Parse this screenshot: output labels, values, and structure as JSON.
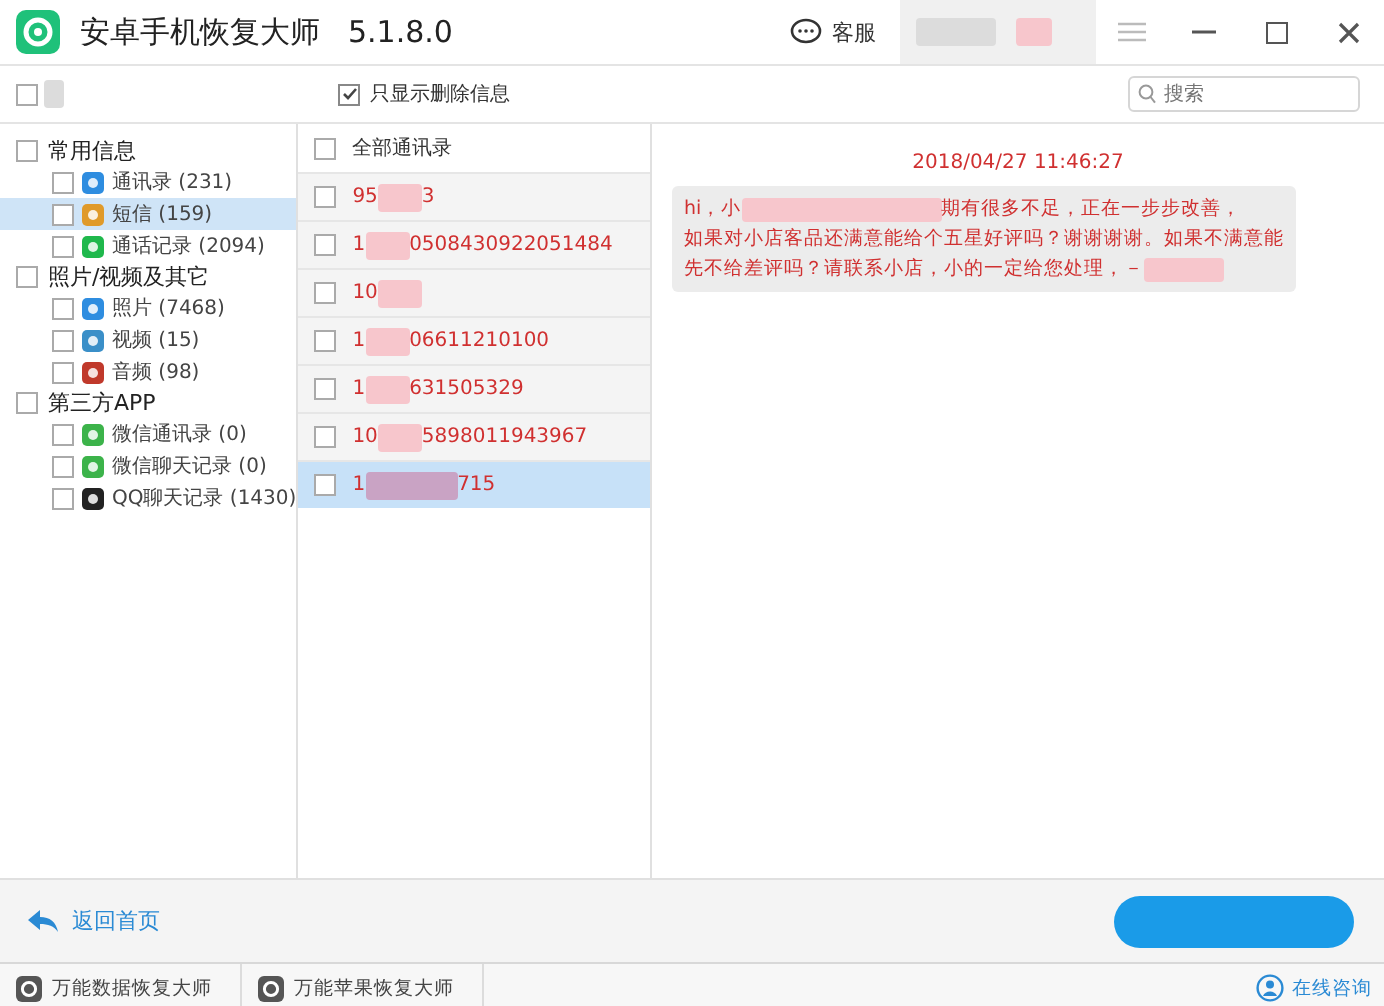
{
  "window": {
    "title": "安卓手机恢复大师",
    "version": "5.1.8.0",
    "support": "客服"
  },
  "toolbar": {
    "select_all_checked": false,
    "deleted_only": {
      "label": "只显示删除信息",
      "checked": true
    },
    "search": {
      "placeholder": "搜索"
    }
  },
  "sidebar": {
    "groups": [
      {
        "label": "常用信息",
        "checked": false,
        "children": [
          {
            "label": "通讯录 (231)",
            "kind": "contacts",
            "checked": false,
            "selected": false
          },
          {
            "label": "短信 (159)",
            "kind": "sms",
            "checked": false,
            "selected": true
          },
          {
            "label": "通话记录 (2094)",
            "kind": "phone",
            "checked": false,
            "selected": false
          }
        ]
      },
      {
        "label": "照片/视频及其它",
        "checked": false,
        "children": [
          {
            "label": "照片 (7468)",
            "kind": "photo",
            "checked": false,
            "selected": false
          },
          {
            "label": "视频 (15)",
            "kind": "video",
            "checked": false,
            "selected": false
          },
          {
            "label": "音频 (98)",
            "kind": "audio",
            "checked": false,
            "selected": false
          }
        ]
      },
      {
        "label": "第三方APP",
        "checked": false,
        "children": [
          {
            "label": "微信通讯录 (0)",
            "kind": "wechat",
            "checked": false,
            "selected": false
          },
          {
            "label": "微信聊天记录 (0)",
            "kind": "wechat",
            "checked": false,
            "selected": false
          },
          {
            "label": "QQ聊天记录 (1430)",
            "kind": "qq",
            "checked": false,
            "selected": false
          }
        ]
      }
    ]
  },
  "contacts": {
    "header": {
      "label": "全部通讯录",
      "checked": false
    },
    "rows": [
      {
        "prefix": "95",
        "suffix": "3",
        "checked": false,
        "selected": false
      },
      {
        "prefix": "1",
        "suffix": "0508430922051484",
        "checked": false,
        "selected": false
      },
      {
        "prefix": "10",
        "checked": false,
        "selected": false
      },
      {
        "prefix": "1",
        "suffix": "06611210100",
        "checked": false,
        "selected": false
      },
      {
        "prefix": "1",
        "suffix": "631505329",
        "checked": false,
        "selected": false
      },
      {
        "prefix": "10",
        "suffix": "5898011943967",
        "checked": false,
        "selected": false
      },
      {
        "prefix": "1",
        "suffix": "715",
        "checked": false,
        "selected": true
      }
    ]
  },
  "messages": [
    {
      "time": "2018/04/27 11:46:27",
      "lines": [
        {
          "before": "hi，小",
          "after": "期有很多不足，正在一步步改善，"
        },
        {
          "before": "如果对小店客品还满意能给个五星好评吗？谢谢谢谢。如果不满意能"
        },
        {
          "before": "先不给差评吗？请联系小店，小的一定给您处理，－",
          "redacted_end": true
        }
      ]
    }
  ],
  "footer": {
    "back": "返回首页"
  },
  "status_bar": {
    "apps": [
      "万能数据恢复大师",
      "万能苹果恢复大师"
    ],
    "consult": "在线咨询"
  }
}
